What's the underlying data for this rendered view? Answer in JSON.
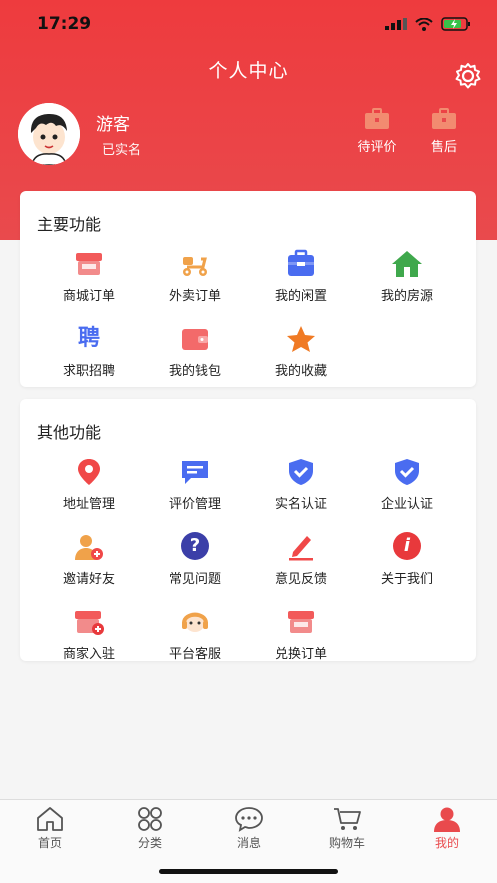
{
  "status": {
    "time": "17:29"
  },
  "header": {
    "title": "个人中心"
  },
  "user": {
    "name": "游客",
    "status": "已实名"
  },
  "header_actions": [
    {
      "label": "待评价",
      "icon": "briefcase-icon"
    },
    {
      "label": "售后",
      "icon": "briefcase-icon"
    }
  ],
  "main_section": {
    "title": "主要功能",
    "items": [
      {
        "label": "商城订单",
        "icon": "shop-icon"
      },
      {
        "label": "外卖订单",
        "icon": "scooter-icon"
      },
      {
        "label": "我的闲置",
        "icon": "box-icon"
      },
      {
        "label": "我的房源",
        "icon": "house-icon"
      },
      {
        "label": "求职招聘",
        "icon": "hire-icon",
        "glyph": "聘"
      },
      {
        "label": "我的钱包",
        "icon": "wallet-icon"
      },
      {
        "label": "我的收藏",
        "icon": "star-icon"
      }
    ]
  },
  "other_section": {
    "title": "其他功能",
    "items": [
      {
        "label": "地址管理",
        "icon": "location-pin-icon"
      },
      {
        "label": "评价管理",
        "icon": "comment-icon"
      },
      {
        "label": "实名认证",
        "icon": "shield-check-icon"
      },
      {
        "label": "企业认证",
        "icon": "shield-check-icon"
      },
      {
        "label": "邀请好友",
        "icon": "add-user-icon"
      },
      {
        "label": "常见问题",
        "icon": "question-icon",
        "glyph": "?"
      },
      {
        "label": "意见反馈",
        "icon": "edit-icon"
      },
      {
        "label": "关于我们",
        "icon": "info-icon",
        "glyph": "i"
      },
      {
        "label": "商家入驻",
        "icon": "shop-add-icon"
      },
      {
        "label": "平台客服",
        "icon": "customer-service-icon"
      },
      {
        "label": "兑换订单",
        "icon": "shop-icon"
      }
    ]
  },
  "tabs": [
    {
      "label": "首页",
      "icon": "home-icon",
      "active": false
    },
    {
      "label": "分类",
      "icon": "category-icon",
      "active": false
    },
    {
      "label": "消息",
      "icon": "message-icon",
      "active": false
    },
    {
      "label": "购物车",
      "icon": "cart-icon",
      "active": false
    },
    {
      "label": "我的",
      "icon": "user-icon",
      "active": true
    }
  ],
  "colors": {
    "brand": "#e94a4d",
    "blue": "#4a6cf0",
    "orange": "#f0a24a"
  }
}
